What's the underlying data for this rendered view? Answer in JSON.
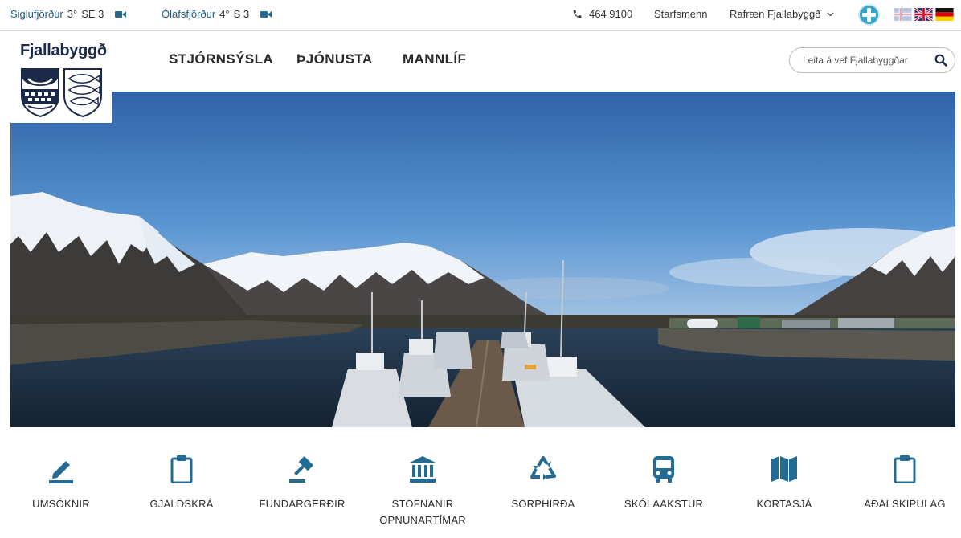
{
  "weather": [
    {
      "place": "Siglufjörður",
      "temp": "3°",
      "wind": "SE 3",
      "icon": "video-camera-icon"
    },
    {
      "place": "Ólafsfjörður",
      "temp": "4°",
      "wind": "S 3",
      "icon": "video-camera-icon"
    }
  ],
  "topbar": {
    "phone": "464 9100",
    "phone_icon": "phone-icon",
    "staff_link": "Starfsmenn",
    "e_services": "Rafræn Fjallabyggð",
    "accessibility_icon": "accessibility-icon",
    "languages": [
      {
        "name": "Icelandic",
        "icon": "iceland-flag-icon"
      },
      {
        "name": "English",
        "icon": "uk-flag-icon"
      },
      {
        "name": "German",
        "icon": "germany-flag-icon"
      }
    ]
  },
  "header": {
    "logo_text": "Fjallabyggð",
    "nav": [
      "STJÓRNSÝSLA",
      "ÞJÓNUSTA",
      "MANNLÍF"
    ],
    "search_placeholder": "Leita á vef Fjallabyggðar"
  },
  "hero": {
    "description": "Panoramic photo of a harbor with fishing boats and snow-covered mountains",
    "sky_color": "#3f7cc0",
    "water_color": "#1e3146"
  },
  "quick_links": [
    {
      "label": "UMSÓKNIR",
      "icon": "pencil-icon"
    },
    {
      "label": "GJALDSKRÁ",
      "icon": "clipboard-icon"
    },
    {
      "label": "FUNDARGERÐIR",
      "icon": "gavel-icon"
    },
    {
      "label": "STOFNANIR OPNUNARTÍMAR",
      "icon": "institution-icon"
    },
    {
      "label": "SORPHIRÐA",
      "icon": "recycle-icon"
    },
    {
      "label": "SKÓLAAKSTUR",
      "icon": "bus-icon"
    },
    {
      "label": "KORTASJÁ",
      "icon": "map-icon"
    },
    {
      "label": "AÐALSKIPULAG",
      "icon": "clipboard-icon"
    }
  ],
  "colors": {
    "accent": "#246b94",
    "text": "#2b2b2b",
    "divider": "#d9d9d9"
  }
}
